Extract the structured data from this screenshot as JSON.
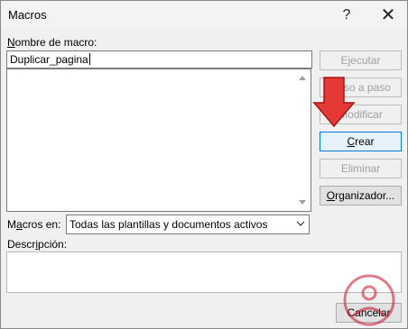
{
  "window": {
    "title": "Macros",
    "help_symbol": "?",
    "close_symbol": "✕"
  },
  "macro_name": {
    "label_accel": "N",
    "label_rest": "ombre de macro:",
    "value": "Duplicar_pagina"
  },
  "buttons": {
    "ejecutar": "Ejecutar",
    "paso_a_paso": "Paso a paso",
    "modificar": "Modificar",
    "crear_accel": "C",
    "crear_rest": "rear",
    "eliminar": "Eliminar",
    "organizador_accel": "O",
    "organizador_rest": "rganizador..."
  },
  "macros_en": {
    "label_pre": "M",
    "label_accel": "a",
    "label_rest": "cros en:",
    "selected": "Todas las plantillas y documentos activos"
  },
  "descripcion": {
    "label_pre": "Descr",
    "label_accel": "i",
    "label_rest": "pción:"
  },
  "cancel_label": "Cancelar",
  "icons": [
    "help-icon",
    "close-icon",
    "scroll-up-icon",
    "scroll-down-icon",
    "chevron-down-icon",
    "red-arrow-icon",
    "watermark-logo-icon"
  ],
  "colors": {
    "focus_border": "#0078d7",
    "arrow": "#e53935",
    "disabled_text": "#a0a0a0"
  }
}
